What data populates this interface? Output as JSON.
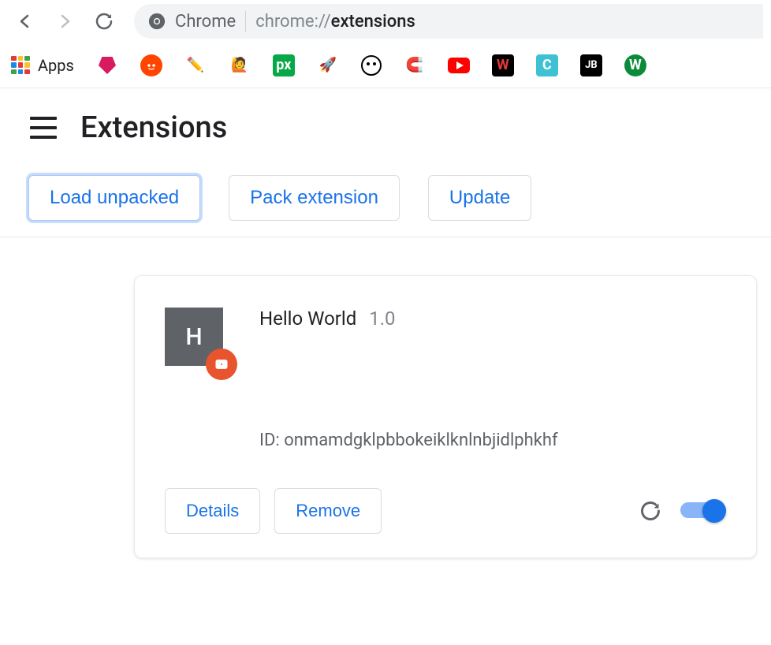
{
  "toolbar": {
    "app_name": "Chrome",
    "url_prefix": "chrome://",
    "url_path": "extensions"
  },
  "bookmarks": {
    "apps_label": "Apps",
    "icons": [
      {
        "name": "pink-diamond",
        "bg": "transparent"
      },
      {
        "name": "reddit",
        "bg": "#ff4500"
      },
      {
        "name": "pencil",
        "bg": "transparent"
      },
      {
        "name": "person",
        "bg": "transparent"
      },
      {
        "name": "px-green",
        "bg": "#06a847"
      },
      {
        "name": "rocket",
        "bg": "transparent"
      },
      {
        "name": "face-bw",
        "bg": "transparent"
      },
      {
        "name": "magnet",
        "bg": "transparent"
      },
      {
        "name": "youtube",
        "bg": "transparent"
      },
      {
        "name": "w-black",
        "bg": "#000"
      },
      {
        "name": "c-teal",
        "bg": "#3ec1d3"
      },
      {
        "name": "jb-black",
        "bg": "#000"
      },
      {
        "name": "w-green",
        "bg": "#0b8b3a"
      }
    ]
  },
  "page": {
    "title": "Extensions"
  },
  "actions": {
    "load_unpacked": "Load unpacked",
    "pack_extension": "Pack extension",
    "update": "Update"
  },
  "extension": {
    "icon_letter": "H",
    "name": "Hello World",
    "version": "1.0",
    "id_label": "ID:",
    "id_value": "onmamdgklpbbokeiklknlnbjidlphkhf",
    "details_label": "Details",
    "remove_label": "Remove",
    "enabled": true
  }
}
